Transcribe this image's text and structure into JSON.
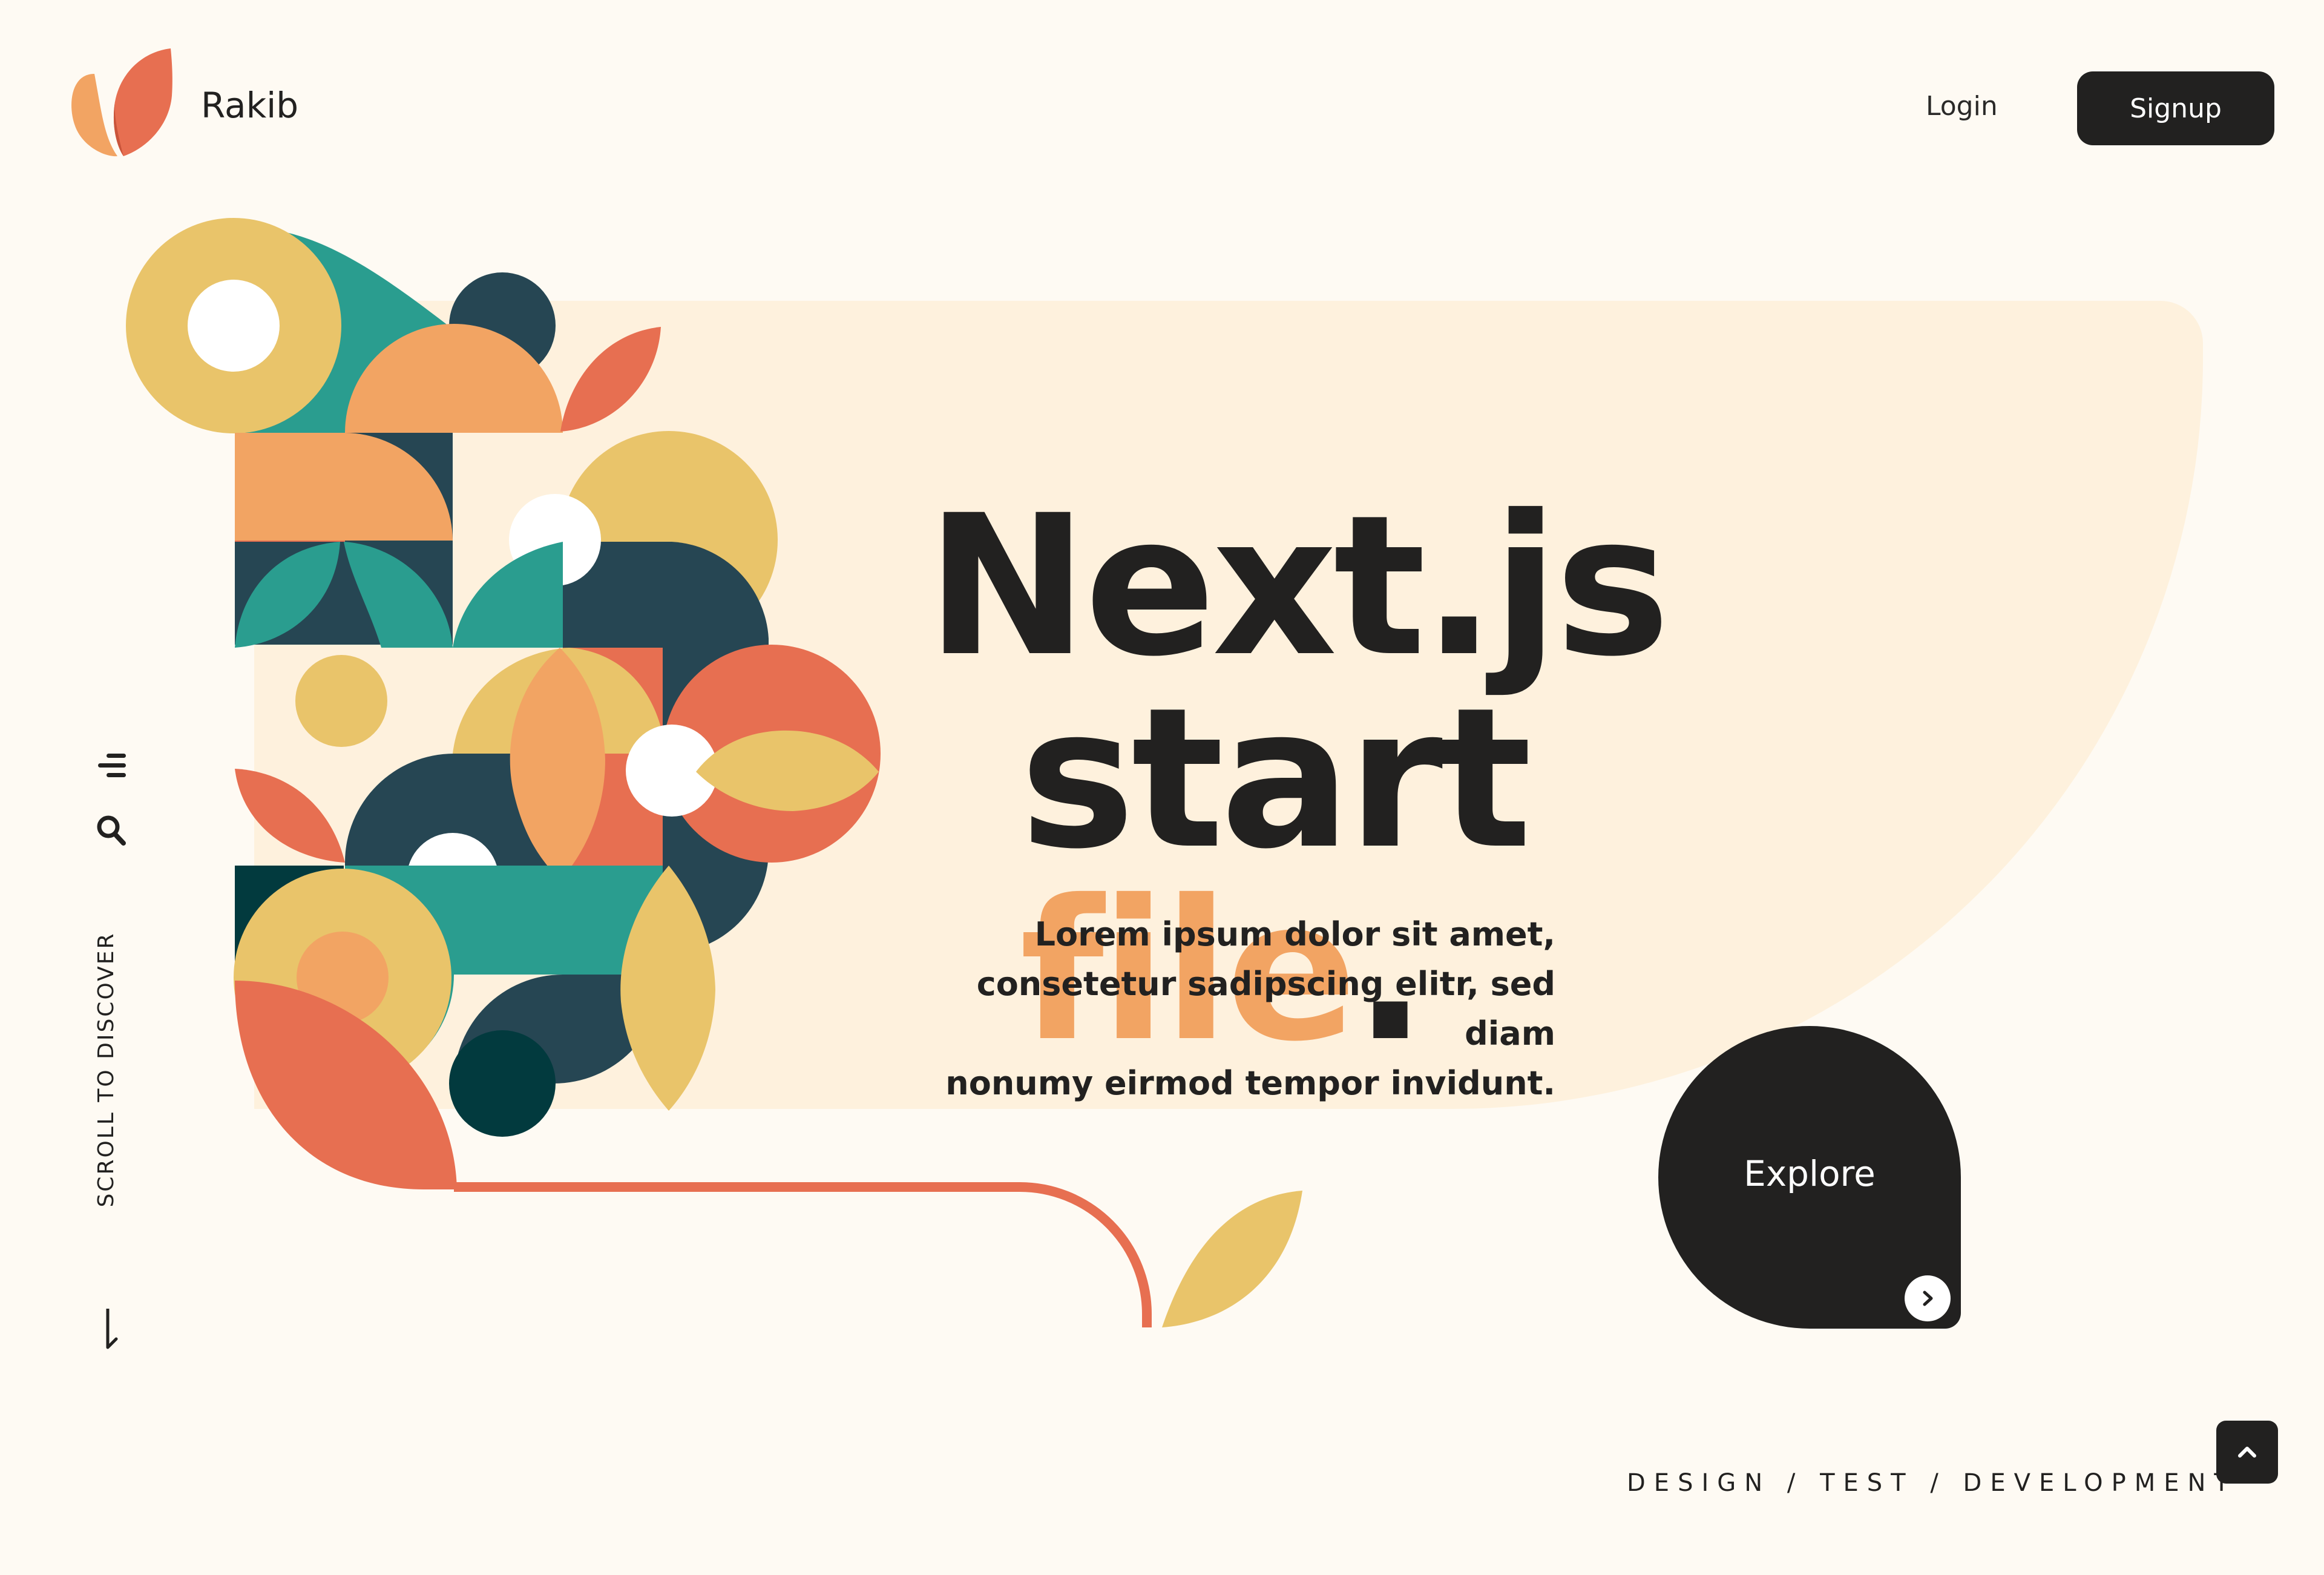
{
  "header": {
    "brand_name": "Rakib",
    "login_label": "Login",
    "signup_label": "Signup"
  },
  "hero": {
    "title_line1": "Next.js",
    "title_word": "start",
    "title_accent": "file",
    "title_period": ".",
    "description_lines": [
      "Lorem ipsum dolor sit amet,",
      "consetetur sadipscing elitr, sed diam",
      "nonumy eirmod tempor invidunt."
    ],
    "explore_label": "Explore"
  },
  "side_nav": {
    "scroll_label": "SCROLL TO DISCOVER",
    "icons": [
      "menu-icon",
      "search-icon",
      "arrow-down-icon"
    ]
  },
  "footer": {
    "tagline": "DESIGN / TEST / DEVELOPMENT",
    "back_to_top_icon": "chevron-up-icon"
  },
  "colors": {
    "background": "#fefaf3",
    "panel": "#fef1dd",
    "dark": "#222120",
    "accent_orange": "#f2a463",
    "coral": "#e76f51",
    "teal": "#2a9d8f",
    "navy": "#264653",
    "mustard": "#e9c46a",
    "deep_teal": "#023a3e"
  }
}
